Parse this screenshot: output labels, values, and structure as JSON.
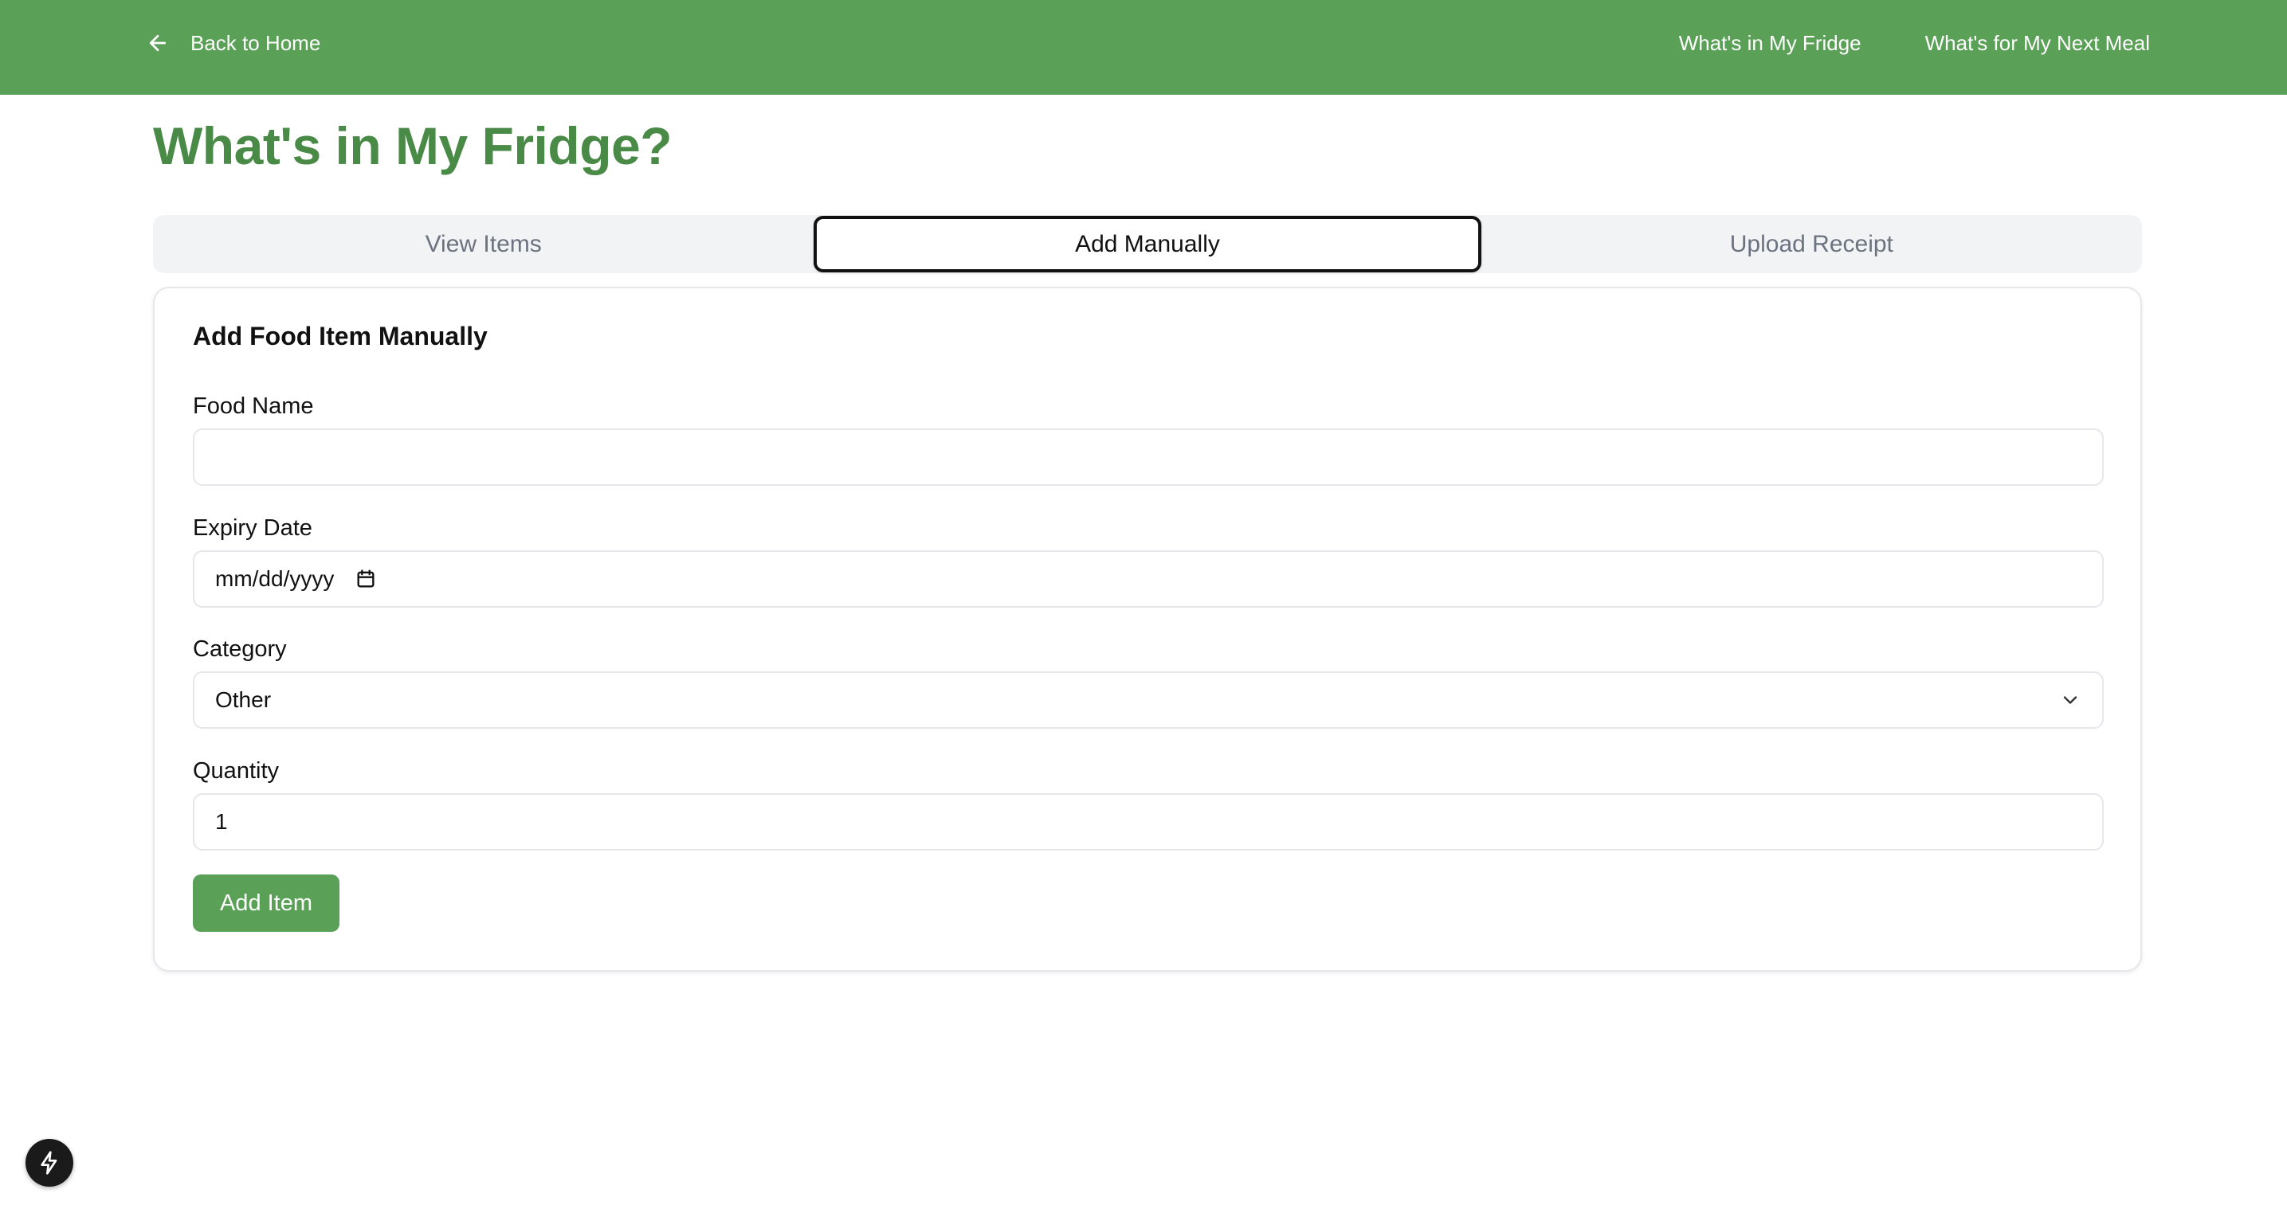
{
  "header": {
    "back_label": "Back to Home",
    "nav": [
      {
        "label": "What's in My Fridge"
      },
      {
        "label": "What's for My Next Meal"
      }
    ]
  },
  "page": {
    "title": "What's in My Fridge?"
  },
  "tabs": [
    {
      "label": "View Items",
      "active": false
    },
    {
      "label": "Add Manually",
      "active": true
    },
    {
      "label": "Upload Receipt",
      "active": false
    }
  ],
  "form": {
    "title": "Add Food Item Manually",
    "food_name": {
      "label": "Food Name",
      "value": "",
      "placeholder": ""
    },
    "expiry_date": {
      "label": "Expiry Date",
      "placeholder": "mm/dd/yyyy"
    },
    "category": {
      "label": "Category",
      "value": "Other"
    },
    "quantity": {
      "label": "Quantity",
      "value": "1"
    },
    "submit_label": "Add Item"
  },
  "colors": {
    "brand_green": "#5aa057",
    "title_green": "#4a8a47",
    "tab_bg": "#f2f3f5",
    "border": "#e5e7eb"
  },
  "icons": {
    "back": "arrow-left-icon",
    "calendar": "calendar-icon",
    "select": "chevron-down-icon",
    "fab": "lightning-bolt-icon"
  }
}
